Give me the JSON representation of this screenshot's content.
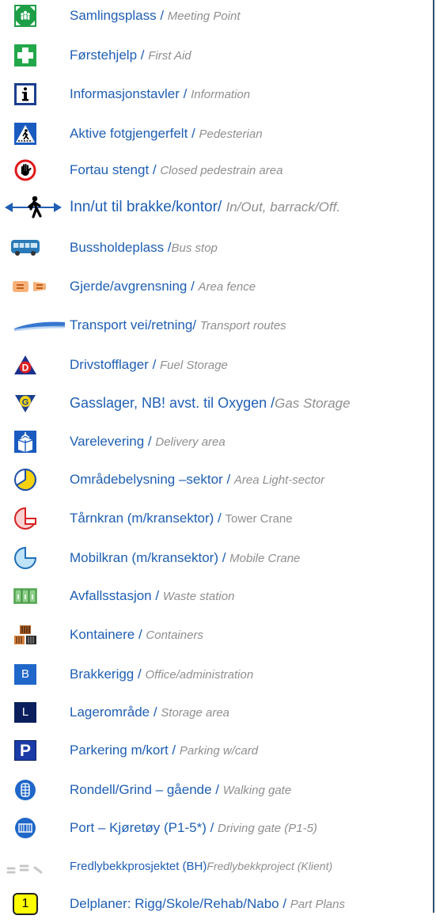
{
  "legend": [
    {
      "icon": "assembly-point-icon",
      "no": "Samlingsplass",
      "sep": " / ",
      "en": "Meeting Point"
    },
    {
      "icon": "first-aid-icon",
      "no": "Førstehjelp",
      "sep": " / ",
      "en": "First Aid"
    },
    {
      "icon": "information-icon",
      "no": "Informasjonstavler",
      "sep": " / ",
      "en": "Information"
    },
    {
      "icon": "pedestrian-crossing-icon",
      "no": "Aktive fotgjengerfelt",
      "sep": " / ",
      "en": "Pedesterian"
    },
    {
      "icon": "stop-hand-icon",
      "no": "Fortau stengt",
      "sep": " / ",
      "en": "Closed pedestrain area"
    },
    {
      "icon": "walking-person-icon",
      "no": "Inn/ut til brakke/kontor",
      "sep": "/ ",
      "en": "In/Out, barrack/Off."
    },
    {
      "icon": "bus-icon",
      "no": "Bussholdeplass",
      "sep": " /",
      "en": "Bus stop"
    },
    {
      "icon": "fence-icon",
      "no": "Gjerde/avgrensning",
      "sep": " / ",
      "en": "Area fence"
    },
    {
      "icon": "transport-route-icon",
      "no": "Transport vei/retning",
      "sep": "/ ",
      "en": "Transport routes"
    },
    {
      "icon": "fuel-storage-icon",
      "no": "Drivstofflager",
      "sep": " / ",
      "en": "Fuel Storage"
    },
    {
      "icon": "gas-storage-icon",
      "no": "Gasslager, NB! avst. til Oxygen",
      "sep": " /",
      "en": "Gas Storage"
    },
    {
      "icon": "delivery-icon",
      "no": "Varelevering",
      "sep": " / ",
      "en": "Delivery area"
    },
    {
      "icon": "area-light-icon",
      "no": "Områdebelysning –sektor",
      "sep": " / ",
      "en": "Area Light-sector"
    },
    {
      "icon": "tower-crane-icon",
      "no": "Tårnkran (m/kransektor)",
      "sep": " / ",
      "en": "Tower Crane"
    },
    {
      "icon": "mobile-crane-icon",
      "no": "Mobilkran (m/kransektor)",
      "sep": " / ",
      "en": "Mobile Crane"
    },
    {
      "icon": "waste-station-icon",
      "no": "Avfallsstasjon",
      "sep": " / ",
      "en": "Waste station"
    },
    {
      "icon": "containers-icon",
      "no": "Kontainere",
      "sep": " / ",
      "en": "Containers"
    },
    {
      "icon": "office-b-icon",
      "no": "Brakkerigg",
      "sep": " / ",
      "en": "Office/administration"
    },
    {
      "icon": "storage-l-icon",
      "no": "Lagerområde",
      "sep": " / ",
      "en": "Storage area"
    },
    {
      "icon": "parking-icon",
      "no": "Parkering m/kort",
      "sep": " / ",
      "en": "Parking w/card"
    },
    {
      "icon": "walking-gate-icon",
      "no": "Rondell/Grind – gående",
      "sep": " / ",
      "en": "Walking gate"
    },
    {
      "icon": "driving-gate-icon",
      "no": "Port – Kjøretøy (P1-5*)",
      "sep": " / ",
      "en": "Driving gate (P1-5)"
    },
    {
      "icon": "project-boundary-icon",
      "no": "Fredlybekkprosjektet (BH)",
      "sep": "",
      "en": "Fredlybekkproject (Klient)"
    },
    {
      "icon": "part-plan-icon",
      "no": "Delplaner: Rigg/Skole/Rehab/Nabo",
      "sep": " / ",
      "en": "Part Plans",
      "badge": "1"
    }
  ],
  "letters": {
    "fuel": "D",
    "gas": "G",
    "office": "B",
    "storage": "L",
    "parking": "P"
  },
  "colors": {
    "blue_text": "#1f5fb4",
    "grey_text": "#8f8f8f",
    "green": "#27a844",
    "navy": "#0a1f5c"
  }
}
